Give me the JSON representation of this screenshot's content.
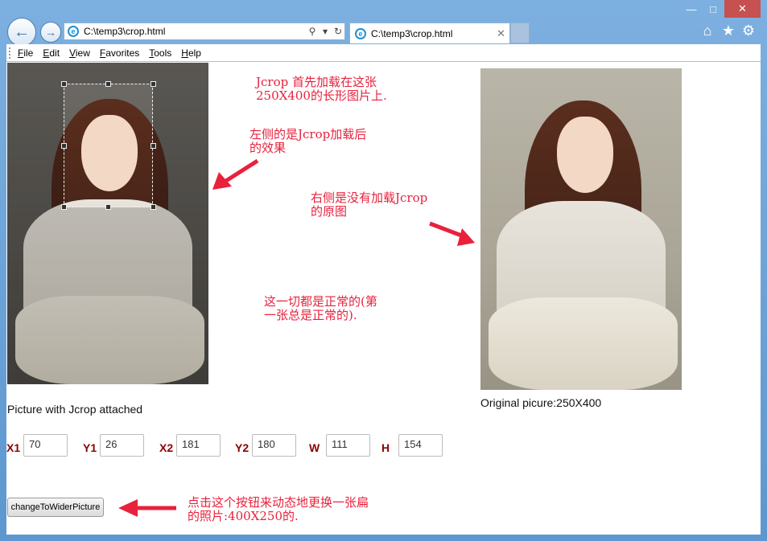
{
  "window": {
    "minimize_glyph": "—",
    "maximize_glyph": "□",
    "close_glyph": "✕"
  },
  "browser": {
    "address": "C:\\temp3\\crop.html",
    "tab_title": "C:\\temp3\\crop.html",
    "search_glyph": "⚲",
    "dropdown_glyph": "▾",
    "refresh_glyph": "↻",
    "tab_close_glyph": "✕",
    "back_glyph": "←",
    "forward_glyph": "→",
    "ie_glyph": "e",
    "home_glyph": "⌂",
    "favorites_glyph": "★",
    "settings_glyph": "⚙"
  },
  "menu": [
    "File",
    "Edit",
    "View",
    "Favorites",
    "Tools",
    "Help"
  ],
  "page": {
    "left_caption": "Picture with Jcrop attached",
    "right_caption": "Original picure:250X400",
    "notes": {
      "n1": "Jcrop 首先加载在这张\n250X400的长形图片上.",
      "n2": "左侧的是Jcrop加载后\n的效果",
      "n3": "右侧是没有加载Jcrop\n的原图",
      "n4": "这一切都是正常的(第\n一张总是正常的).",
      "n5": "点击这个按钮来动态地更换一张扁\n的照片:400X250的."
    },
    "coords": {
      "x1": {
        "label": "X1",
        "value": "70"
      },
      "y1": {
        "label": "Y1",
        "value": "26"
      },
      "x2": {
        "label": "X2",
        "value": "181"
      },
      "y2": {
        "label": "Y2",
        "value": "180"
      },
      "w": {
        "label": "W",
        "value": "111"
      },
      "h": {
        "label": "H",
        "value": "154"
      }
    },
    "button_label": "changeToWiderPicture"
  },
  "colors": {
    "annotation": "#e8213c",
    "coord_label": "#8b0000"
  }
}
